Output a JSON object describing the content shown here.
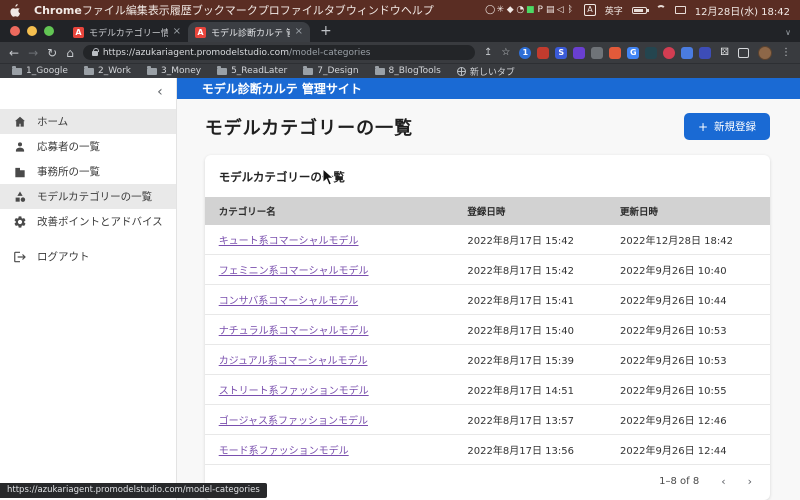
{
  "menubar": {
    "items": [
      {
        "label": "Chrome",
        "cls": "bold"
      },
      {
        "label": "ファイル"
      },
      {
        "label": "編集"
      },
      {
        "label": "表示"
      },
      {
        "label": "履歴"
      },
      {
        "label": "ブックマーク"
      },
      {
        "label": "プロファイル"
      },
      {
        "label": "タブ"
      },
      {
        "label": "ウィンドウ"
      },
      {
        "label": "ヘルプ"
      }
    ],
    "status_icons": [
      {
        "glyph": "◯"
      },
      {
        "glyph": "✳"
      },
      {
        "glyph": "◆"
      },
      {
        "glyph": "◔"
      },
      {
        "glyph": "■",
        "color": "#4cd964"
      },
      {
        "glyph": "P"
      },
      {
        "glyph": "▤"
      },
      {
        "glyph": "◁"
      },
      {
        "glyph": "ᛒ"
      }
    ],
    "input_badge": "A",
    "input_label": "英字",
    "datetime": "12月28日(水) 18:42"
  },
  "browser": {
    "tabs": [
      {
        "title": "モデルカテゴリー情報 | AZUKA",
        "favicon_letter": "A",
        "state": "inactive",
        "close": "×"
      },
      {
        "title": "モデル診断カルテ 管理サイト",
        "favicon_letter": "A",
        "state": "active",
        "close": "×"
      }
    ],
    "new_tab_button": "+",
    "tab_search_chevron": "∨",
    "nav": {
      "back": "←",
      "forward": "→",
      "reload": "↻",
      "home": "⌂"
    },
    "url_host": "https://azukariagent.promodelstudio.com",
    "url_path": "/model-categories",
    "share_icon": "↥",
    "star_icon": "☆",
    "extensions": [
      {
        "glyph": "1",
        "color": "#2f6fd6",
        "cls": "round"
      },
      {
        "glyph": "",
        "color": "#c23b2e"
      },
      {
        "glyph": "S",
        "color": "#3b5bd9"
      },
      {
        "glyph": "",
        "color": "#6a3fd1"
      },
      {
        "glyph": "",
        "color": "#6f7378"
      },
      {
        "glyph": "",
        "color": "#e25a3a"
      },
      {
        "glyph": "G",
        "color": "#4285f4"
      },
      {
        "glyph": "",
        "color": "#24454f"
      },
      {
        "glyph": "",
        "color": "#d23d52",
        "cls": "round"
      },
      {
        "glyph": "",
        "color": "#4a7ce0"
      },
      {
        "glyph": "",
        "color": "#3d4db7"
      }
    ],
    "puzzle_icon": "⚄",
    "kebab_icon": "⋮",
    "bookmarks": [
      {
        "label": "1_Google"
      },
      {
        "label": "2_Work"
      },
      {
        "label": "3_Money"
      },
      {
        "label": "5_ReadLater"
      },
      {
        "label": "7_Design"
      },
      {
        "label": "8_BlogTools"
      }
    ],
    "new_tab_bookmark": "新しいタブ"
  },
  "app": {
    "appbar_title": "モデル診断カルテ 管理サイト",
    "collapse_chevron": "‹",
    "sidebar": {
      "items": [
        {
          "label": "ホーム",
          "state": "active"
        },
        {
          "label": "応募者の一覧",
          "state": "normal"
        },
        {
          "label": "事務所の一覧",
          "state": "normal"
        },
        {
          "label": "モデルカテゴリーの一覧",
          "state": "active"
        },
        {
          "label": "改善ポイントとアドバイス",
          "state": "normal"
        },
        {
          "label": "ログアウト",
          "state": "normal"
        }
      ]
    },
    "page_title": "モデルカテゴリーの一覧",
    "new_button_label": "新規登録",
    "new_button_plus": "+",
    "card": {
      "title": "モデルカテゴリーの一覧",
      "columns": [
        "カテゴリー名",
        "登録日時",
        "更新日時"
      ],
      "rows": [
        {
          "name": "キュート系コマーシャルモデル",
          "registered": "2022年8月17日 15:42",
          "updated": "2022年12月28日 18:42"
        },
        {
          "name": "フェミニン系コマーシャルモデル",
          "registered": "2022年8月17日 15:42",
          "updated": "2022年9月26日 10:40"
        },
        {
          "name": "コンサバ系コマーシャルモデル",
          "registered": "2022年8月17日 15:41",
          "updated": "2022年9月26日 10:44"
        },
        {
          "name": "ナチュラル系コマーシャルモデル",
          "registered": "2022年8月17日 15:40",
          "updated": "2022年9月26日 10:53"
        },
        {
          "name": "カジュアル系コマーシャルモデル",
          "registered": "2022年8月17日 15:39",
          "updated": "2022年9月26日 10:53"
        },
        {
          "name": "ストリート系ファッションモデル",
          "registered": "2022年8月17日 14:51",
          "updated": "2022年9月26日 10:55"
        },
        {
          "name": "ゴージャス系ファッションモデル",
          "registered": "2022年8月17日 13:57",
          "updated": "2022年9月26日 12:46"
        },
        {
          "name": "モード系ファッションモデル",
          "registered": "2022年8月17日 13:56",
          "updated": "2022年9月26日 12:44"
        }
      ],
      "pagination": "1–8 of 8",
      "prev_chevron": "‹",
      "next_chevron": "›"
    }
  },
  "status_tooltip": "https://azukariagent.promodelstudio.com/model-categories",
  "colors": {
    "menubar_maroon": "#5a2d23",
    "frame_dark": "#212327",
    "toolbar_gray": "#393b3f",
    "appbar_blue": "#1a6ad4",
    "button_blue": "#1a6ad4",
    "link_purple": "#7a4fae",
    "table_header_gray": "#d2d2d2",
    "sidebar_active_gray": "#e9e9e9",
    "traffic_red": "#ed6a5e",
    "traffic_yellow": "#f5bf4f",
    "traffic_green": "#62c554"
  }
}
